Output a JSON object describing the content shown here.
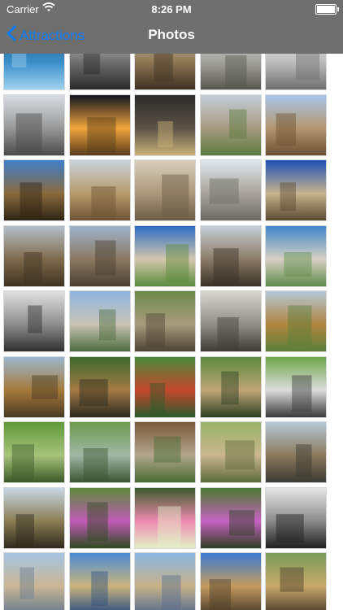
{
  "status_bar": {
    "carrier": "Carrier",
    "time": "8:26 PM"
  },
  "nav": {
    "back_label": "Attractions",
    "title": "Photos"
  },
  "icons": {
    "back": "chevron-left-icon",
    "wifi": "wifi-icon",
    "battery": "battery-icon"
  },
  "colors": {
    "nav_bg": "#6f6f6f",
    "accent": "#0a7cff"
  },
  "photos": [
    {
      "name": "photo-glass-building",
      "colors": [
        "#1e5a8c",
        "#3b8fc9",
        "#9fd2ef"
      ]
    },
    {
      "name": "photo-street-arcade",
      "colors": [
        "#cfcfcf",
        "#6d6d6d",
        "#2b2b2b"
      ]
    },
    {
      "name": "photo-interior-hall",
      "colors": [
        "#d8c7a2",
        "#8c7553",
        "#3e3223"
      ]
    },
    {
      "name": "photo-colonnade-square",
      "colors": [
        "#d0d8df",
        "#a1a19a",
        "#575750"
      ]
    },
    {
      "name": "photo-white-facade",
      "colors": [
        "#f3f3f3",
        "#bdbdbd",
        "#6e6e6e"
      ]
    },
    {
      "name": "photo-grand-theatre",
      "colors": [
        "#d9dde2",
        "#989898",
        "#4a4a4a"
      ]
    },
    {
      "name": "photo-night-theatre",
      "colors": [
        "#101521",
        "#f0a53a",
        "#5a3e1c"
      ]
    },
    {
      "name": "photo-pub-front",
      "colors": [
        "#2b2b2b",
        "#5b5346",
        "#c9b27a"
      ]
    },
    {
      "name": "photo-classical-palace",
      "colors": [
        "#c4cdd7",
        "#a69a80",
        "#5a7a3f"
      ]
    },
    {
      "name": "photo-stone-palace",
      "colors": [
        "#a7c6e8",
        "#b39670",
        "#6a4f33"
      ]
    },
    {
      "name": "photo-gothic-spire-blue",
      "colors": [
        "#3e7fc9",
        "#8a6b3f",
        "#2e2415"
      ]
    },
    {
      "name": "photo-bell-tower",
      "colors": [
        "#c9d3dc",
        "#b59b6c",
        "#6d5434"
      ]
    },
    {
      "name": "photo-stone-sculpture",
      "colors": [
        "#d9cfbd",
        "#a9987a",
        "#6a5d47"
      ]
    },
    {
      "name": "photo-open-square",
      "colors": [
        "#dfe6ec",
        "#a7a39a",
        "#6b6b63"
      ]
    },
    {
      "name": "photo-gothic-tower-sky",
      "colors": [
        "#1c4fb5",
        "#c7b48f",
        "#5b4a31"
      ]
    },
    {
      "name": "photo-cathedral-clouds",
      "colors": [
        "#b6bfc9",
        "#7d6a4c",
        "#3e3322"
      ]
    },
    {
      "name": "photo-cathedral-facade",
      "colors": [
        "#9eb3cb",
        "#8a7a62",
        "#4a3f31"
      ]
    },
    {
      "name": "photo-spire-closeup",
      "colors": [
        "#2d6cc3",
        "#d4c7ad",
        "#5a8a3c"
      ]
    },
    {
      "name": "photo-statue-city",
      "colors": [
        "#c7cfd6",
        "#8a7b67",
        "#3a3128"
      ]
    },
    {
      "name": "photo-monument-fountain",
      "colors": [
        "#3f86c9",
        "#d6d0c3",
        "#5f8b4a"
      ]
    },
    {
      "name": "photo-bw-fountain",
      "colors": [
        "#e0e0e0",
        "#8e8e8e",
        "#2f2f2f"
      ]
    },
    {
      "name": "photo-column-square",
      "colors": [
        "#8fb4dc",
        "#c9c4b7",
        "#4c6b3d"
      ]
    },
    {
      "name": "photo-tortoise",
      "colors": [
        "#6d8a4a",
        "#a89c7f",
        "#4d4333"
      ]
    },
    {
      "name": "photo-sign-board",
      "colors": [
        "#d7d7d0",
        "#8f8f86",
        "#3d3d36"
      ]
    },
    {
      "name": "photo-giraffe-tree",
      "colors": [
        "#b4c8d8",
        "#b0853d",
        "#5c7f3a"
      ]
    },
    {
      "name": "photo-giraffe-fence",
      "colors": [
        "#9cb7ce",
        "#a57a3a",
        "#4a3a24"
      ]
    },
    {
      "name": "photo-kangaroo",
      "colors": [
        "#3d6a2e",
        "#a47a45",
        "#2a2a20"
      ]
    },
    {
      "name": "photo-parrot",
      "colors": [
        "#4a8a3a",
        "#c4472f",
        "#2b5a2a"
      ]
    },
    {
      "name": "photo-leopard",
      "colors": [
        "#5c8a3c",
        "#bfa678",
        "#2d3f22"
      ]
    },
    {
      "name": "photo-lemur",
      "colors": [
        "#6ea64a",
        "#dcdcdc",
        "#3a3a3a"
      ]
    },
    {
      "name": "photo-park-pond",
      "colors": [
        "#5f9a3b",
        "#a8c27a",
        "#3b5a2a"
      ]
    },
    {
      "name": "photo-garden-bridge",
      "colors": [
        "#6e9a4c",
        "#9fb7a6",
        "#3d5533"
      ]
    },
    {
      "name": "photo-garden-house",
      "colors": [
        "#7a5a3c",
        "#b1a68c",
        "#4a6a33"
      ]
    },
    {
      "name": "photo-park-lawn",
      "colors": [
        "#99b46a",
        "#c9b68e",
        "#5d6b3a"
      ]
    },
    {
      "name": "photo-bird-field",
      "colors": [
        "#b6c9d6",
        "#8a7a5c",
        "#3a3a33"
      ]
    },
    {
      "name": "photo-cattle-field",
      "colors": [
        "#c8d6e4",
        "#8a7e55",
        "#2f2a1e"
      ]
    },
    {
      "name": "photo-purple-flowers",
      "colors": [
        "#5c8a3c",
        "#c05bb5",
        "#2f4a22"
      ]
    },
    {
      "name": "photo-water-lily",
      "colors": [
        "#3c5a2c",
        "#ef8ab0",
        "#e2f0c7"
      ]
    },
    {
      "name": "photo-pink-blooms",
      "colors": [
        "#4a7a30",
        "#c663c2",
        "#2f3f22"
      ]
    },
    {
      "name": "photo-bw-statue",
      "colors": [
        "#e7e7e7",
        "#8a8a8a",
        "#202020"
      ]
    },
    {
      "name": "photo-water-mirror",
      "colors": [
        "#a7c4e2",
        "#c9b795",
        "#6b7c90"
      ]
    },
    {
      "name": "photo-place-bourse",
      "colors": [
        "#4b8bd4",
        "#cbb47c",
        "#2d4f7f"
      ]
    },
    {
      "name": "photo-waterfront-palace",
      "colors": [
        "#8bb6e2",
        "#c6b189",
        "#5a6f8d"
      ]
    },
    {
      "name": "photo-fountain-dome",
      "colors": [
        "#3b7bd2",
        "#c49a5e",
        "#4c3e2a"
      ]
    },
    {
      "name": "photo-tree-lane",
      "colors": [
        "#7b9b5a",
        "#c8a96a",
        "#4a3d2a"
      ]
    }
  ]
}
